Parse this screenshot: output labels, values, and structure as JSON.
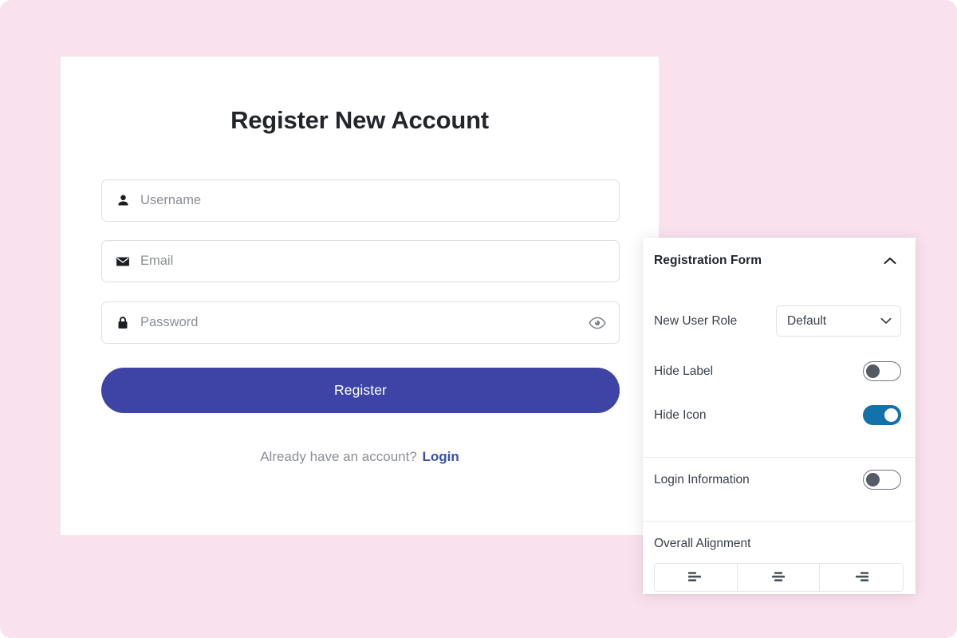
{
  "theme": {
    "page_background": "#f9e2ee",
    "card_background": "#ffffff",
    "primary_button": "#3d44a5",
    "link_color": "#3b4fb0",
    "toggle_on_color": "#1273aa",
    "toggle_off_knob": "#545b66",
    "placeholder_color": "#8b8f96"
  },
  "registration_form": {
    "title": "Register New Account",
    "fields": [
      {
        "name": "username",
        "placeholder": "Username",
        "value": "",
        "icon": "person-icon"
      },
      {
        "name": "email",
        "placeholder": "Email",
        "value": "",
        "icon": "envelope-icon"
      },
      {
        "name": "password",
        "placeholder": "Password",
        "value": "",
        "icon": "lock-icon",
        "trailing_icon": "eye-icon"
      }
    ],
    "submit_label": "Register",
    "footer_text": "Already have an account?",
    "footer_link_label": "Login"
  },
  "settings_panel": {
    "header": {
      "title": "Registration Form",
      "collapse_icon": "chevron-up-icon"
    },
    "role_row": {
      "label": "New User Role",
      "select_value": "Default",
      "select_icon": "chevron-down-icon"
    },
    "toggles": [
      {
        "label": "Hide Label",
        "state": "off"
      },
      {
        "label": "Hide Icon",
        "state": "on"
      },
      {
        "label": "Login Information",
        "state": "off"
      }
    ],
    "alignment": {
      "label": "Overall Alignment",
      "options": [
        {
          "name": "left",
          "icon": "align-left-icon"
        },
        {
          "name": "center",
          "icon": "align-center-icon"
        },
        {
          "name": "right",
          "icon": "align-right-icon"
        }
      ]
    }
  }
}
